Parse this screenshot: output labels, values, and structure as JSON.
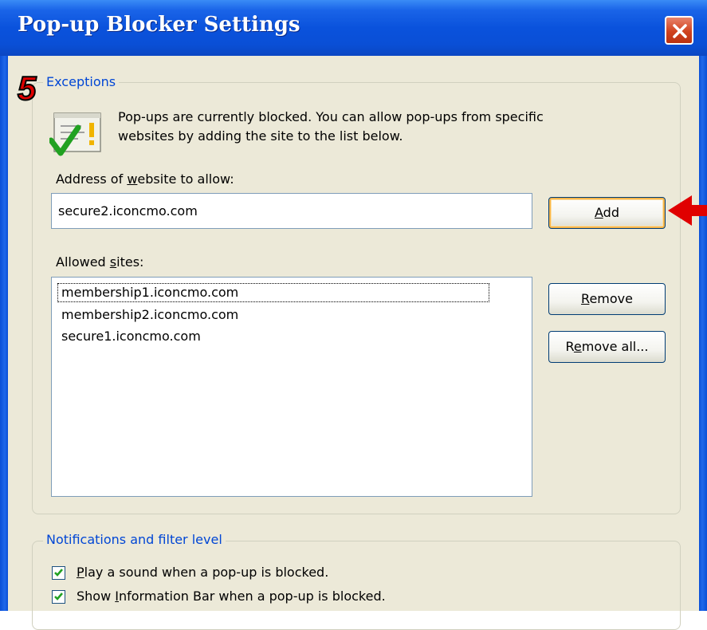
{
  "window": {
    "title": "Pop-up Blocker Settings"
  },
  "annotation": {
    "step_number": "5"
  },
  "exceptions": {
    "group_label": "Exceptions",
    "info_line1": "Pop-ups are currently blocked.  You can allow pop-ups from specific",
    "info_line2": "websites by adding the site to the list below.",
    "address_label_pre": "Address of ",
    "address_label_key": "w",
    "address_label_post": "ebsite to allow:",
    "address_value": "secure2.iconcmo.com",
    "add_key": "A",
    "add_rest": "dd",
    "allowed_label_pre": "Allowed ",
    "allowed_label_key": "s",
    "allowed_label_post": "ites:",
    "allowed_sites": [
      "membership1.iconcmo.com",
      "membership2.iconcmo.com",
      "secure1.iconcmo.com"
    ],
    "remove_key": "R",
    "remove_rest": "emove",
    "remove_all_pre": "R",
    "remove_all_key": "e",
    "remove_all_post": "move all..."
  },
  "notifications": {
    "group_label": "Notifications and filter level",
    "play_sound_key": "P",
    "play_sound_rest": "lay a sound when a pop-up is blocked.",
    "play_sound_checked": true,
    "show_bar_pre": "Show ",
    "show_bar_key": "I",
    "show_bar_post": "nformation Bar when a pop-up is blocked.",
    "show_bar_checked": true
  },
  "colors": {
    "title_bar": "#0a52dc",
    "group_label": "#0046d5",
    "arrow": "#e00000",
    "check": "#21a121"
  }
}
